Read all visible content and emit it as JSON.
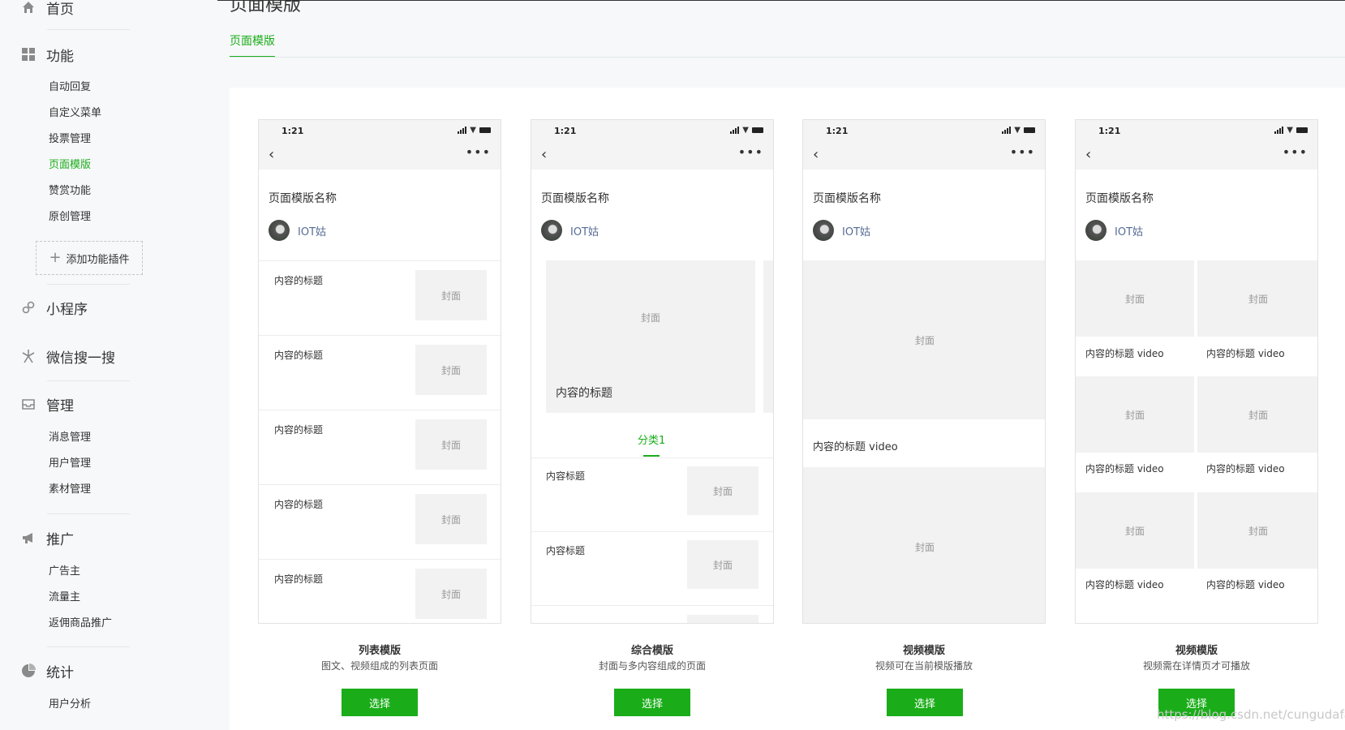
{
  "sidebar": {
    "home": "首页",
    "groups": [
      {
        "title": "功能",
        "icon": "grid-icon",
        "items": [
          "自动回复",
          "自定义菜单",
          "投票管理",
          "页面模版",
          "赞赏功能",
          "原创管理"
        ],
        "active": "页面模版",
        "add_plugin": "添加功能插件"
      },
      {
        "title": "小程序",
        "icon": "link-icon",
        "items": []
      },
      {
        "title": "微信搜一搜",
        "icon": "sparkle-icon",
        "items": []
      },
      {
        "title": "管理",
        "icon": "inbox-icon",
        "items": [
          "消息管理",
          "用户管理",
          "素材管理"
        ]
      },
      {
        "title": "推广",
        "icon": "megaphone-icon",
        "items": [
          "广告主",
          "流量主",
          "返佣商品推广"
        ]
      },
      {
        "title": "统计",
        "icon": "pie-icon",
        "items": [
          "用户分析"
        ]
      }
    ]
  },
  "header": {
    "title": "页面模版",
    "tab": "页面模版"
  },
  "phone": {
    "time": "1:21",
    "page_title": "页面模版名称",
    "author": "IOT姑",
    "cover": "封面",
    "content_title": "内容的标题",
    "content_title_short": "内容标题",
    "video_title": "内容的标题 video",
    "category": "分类1"
  },
  "templates": [
    {
      "name": "列表模版",
      "desc": "图文、视频组成的列表页面",
      "button": "选择"
    },
    {
      "name": "综合模版",
      "desc": "封面与多内容组成的页面",
      "button": "选择"
    },
    {
      "name": "视频模版",
      "desc": "视频可在当前模版播放",
      "button": "选择"
    },
    {
      "name": "视频模版",
      "desc": "视频需在详情页才可播放",
      "button": "选择"
    }
  ],
  "watermark": "https://blog.csdn.net/cungudafa",
  "colors": {
    "accent": "#1aad19",
    "link": "#576b95"
  }
}
